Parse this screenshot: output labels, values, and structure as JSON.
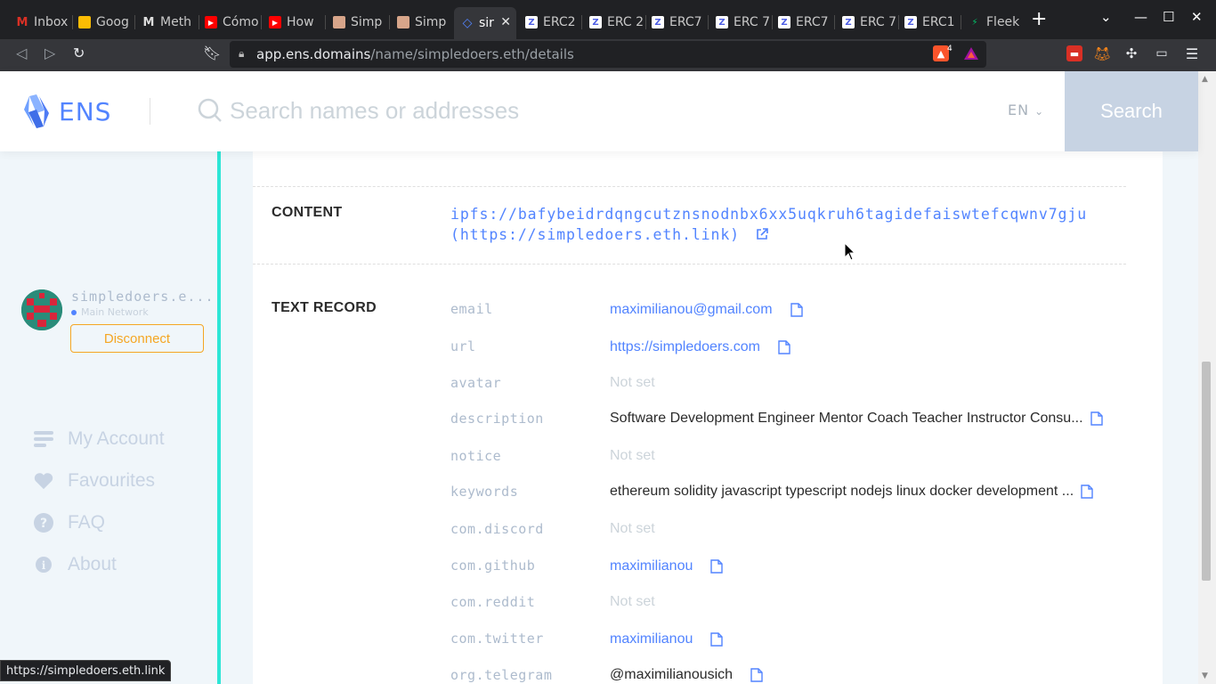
{
  "browser": {
    "tabs": [
      {
        "label": "Inbox",
        "icon": "gmail-icon",
        "color": "#d93025"
      },
      {
        "label": "Goog",
        "icon": "google-keep-icon",
        "color": "#fbbc04"
      },
      {
        "label": "Meth",
        "icon": "medium-icon",
        "color": "#666666"
      },
      {
        "label": "Cómo",
        "icon": "youtube-icon",
        "color": "#ff0000"
      },
      {
        "label": "How",
        "icon": "youtube-icon",
        "color": "#ff0000"
      },
      {
        "label": "Simp",
        "icon": "profile-icon",
        "color": "#d7a58a"
      },
      {
        "label": "Simp",
        "icon": "profile-icon",
        "color": "#d7a58a"
      },
      {
        "label": "sir",
        "icon": "ens-icon",
        "color": "#5284ff"
      },
      {
        "label": "ERC2",
        "icon": "zeppelin-icon",
        "color": "#4e5ee4"
      },
      {
        "label": "ERC 2",
        "icon": "zeppelin-icon",
        "color": "#4e5ee4"
      },
      {
        "label": "ERC7",
        "icon": "zeppelin-icon",
        "color": "#4e5ee4"
      },
      {
        "label": "ERC 7",
        "icon": "zeppelin-icon",
        "color": "#4e5ee4"
      },
      {
        "label": "ERC7",
        "icon": "zeppelin-icon",
        "color": "#4e5ee4"
      },
      {
        "label": "ERC 7",
        "icon": "zeppelin-icon",
        "color": "#4e5ee4"
      },
      {
        "label": "ERC1",
        "icon": "zeppelin-icon",
        "color": "#4e5ee4"
      },
      {
        "label": "Fleek",
        "icon": "fleek-icon",
        "color": "#00c46a"
      }
    ],
    "url_host": "app.ens.domains",
    "url_path": "/name/simpledoers.eth/details",
    "brave_badge": "4",
    "status_url": "https://simpledoers.eth.link"
  },
  "header": {
    "logo_text": "ENS",
    "search_placeholder": "Search names or addresses",
    "lang": "EN",
    "search_button": "Search"
  },
  "sidebar": {
    "account_name": "simpledoers.e...",
    "network": "Main Network",
    "disconnect_label": "Disconnect",
    "items": [
      {
        "label": "My Account",
        "icon": "list-icon"
      },
      {
        "label": "Favourites",
        "icon": "heart-icon"
      },
      {
        "label": "FAQ",
        "icon": "question-icon"
      },
      {
        "label": "About",
        "icon": "info-icon"
      }
    ]
  },
  "details": {
    "content_label": "CONTENT",
    "content_hash": "ipfs://bafybeidrdqngcutznsnodnbx6xx5uqkruh6tagidefaiswtefcqwnv7gju",
    "content_link": "(https://simpledoers.eth.link)",
    "text_record_label": "TEXT RECORD",
    "records": [
      {
        "key": "email",
        "value": "maximilianou@gmail.com",
        "kind": "link",
        "copy": true
      },
      {
        "key": "url",
        "value": "https://simpledoers.com",
        "kind": "link",
        "copy": true
      },
      {
        "key": "avatar",
        "value": "Not set",
        "kind": "notset",
        "copy": false
      },
      {
        "key": "description",
        "value": "Software Development Engineer Mentor Coach Teacher Instructor Consu...",
        "kind": "plain",
        "copy": true
      },
      {
        "key": "notice",
        "value": "Not set",
        "kind": "notset",
        "copy": false
      },
      {
        "key": "keywords",
        "value": "ethereum solidity javascript typescript nodejs linux docker development ...",
        "kind": "plain",
        "copy": true
      },
      {
        "key": "com.discord",
        "value": "Not set",
        "kind": "notset",
        "copy": false
      },
      {
        "key": "com.github",
        "value": "maximilianou",
        "kind": "link",
        "copy": true
      },
      {
        "key": "com.reddit",
        "value": "Not set",
        "kind": "notset",
        "copy": false
      },
      {
        "key": "com.twitter",
        "value": "maximilianou",
        "kind": "link",
        "copy": true
      },
      {
        "key": "org.telegram",
        "value": "@maximilianousich",
        "kind": "plain",
        "copy": true
      }
    ]
  }
}
